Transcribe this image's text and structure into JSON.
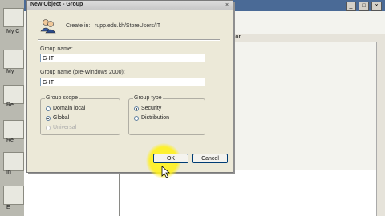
{
  "desktop": {
    "labels": [
      "My C",
      "My",
      "Re",
      "Re",
      "In",
      "E"
    ]
  },
  "background_window": {
    "column_header": "ion"
  },
  "dialog": {
    "title": "New Object - Group",
    "close_glyph": "×",
    "create_in_label": "Create in:",
    "create_in_path": "rupp.edu.kh/StoreUsers/IT",
    "group_name": {
      "label": "Group name:",
      "value": "G-IT"
    },
    "group_name_pre2000": {
      "label": "Group name (pre-Windows 2000):",
      "value": "G-IT"
    },
    "group_scope": {
      "title": "Group scope",
      "options": [
        {
          "label": "Domain local",
          "selected": false,
          "enabled": true
        },
        {
          "label": "Global",
          "selected": true,
          "enabled": true
        },
        {
          "label": "Universal",
          "selected": false,
          "enabled": false
        }
      ]
    },
    "group_type": {
      "title": "Group type",
      "options": [
        {
          "label": "Security",
          "selected": true,
          "enabled": true
        },
        {
          "label": "Distribution",
          "selected": false,
          "enabled": true
        }
      ]
    },
    "ok_label": "OK",
    "cancel_label": "Cancel"
  },
  "colors": {
    "highlight": "#fff528",
    "title_bar_bg": "#4a6a96",
    "dialog_bg": "#ece9d8"
  }
}
